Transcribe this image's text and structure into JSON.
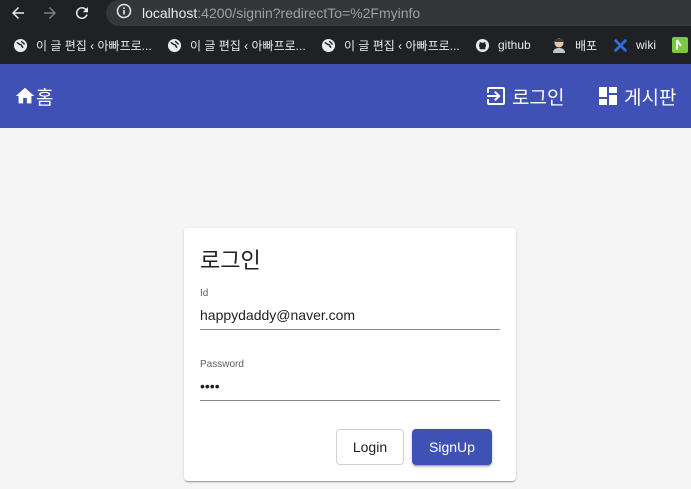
{
  "browser": {
    "url_host": "localhost",
    "url_path": ":4200/signin?redirectTo=%2Fmyinfo",
    "bookmarks": [
      {
        "icon": "globe-icon",
        "label": "이 글 편집 ‹ 아빠프로..."
      },
      {
        "icon": "globe-icon",
        "label": "이 글 편집 ‹ 아빠프로..."
      },
      {
        "icon": "globe-icon",
        "label": "이 글 편집 ‹ 아빠프로..."
      },
      {
        "icon": "github-icon",
        "label": "github"
      },
      {
        "icon": "avatar-icon",
        "label": "배포"
      },
      {
        "icon": "x-icon",
        "label": "wiki"
      }
    ]
  },
  "toolbar": {
    "home_label": "홈",
    "login_label": "로그인",
    "board_label": "게시판"
  },
  "login_card": {
    "title": "로그인",
    "id_label": "Id",
    "id_value": "happydaddy@naver.com",
    "password_label": "Password",
    "password_value": "••••",
    "login_button": "Login",
    "signup_button": "SignUp"
  },
  "colors": {
    "primary": "#3f51b5",
    "chrome": "#202124",
    "background": "#f5f5f5"
  }
}
